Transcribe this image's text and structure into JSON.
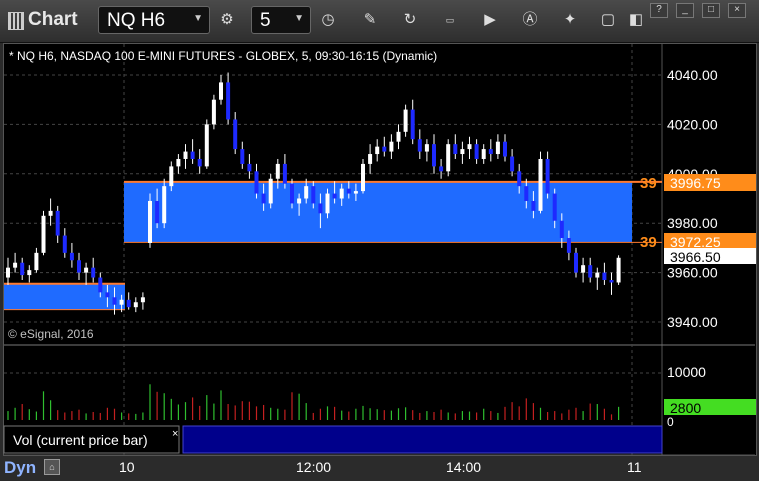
{
  "window": {
    "title": "Chart"
  },
  "toolbar": {
    "symbol": "NQ H6",
    "interval": "5",
    "icons": [
      "settings-icon",
      "clock-icon",
      "pencil-icon",
      "refresh-icon",
      "get-icon",
      "play-icon",
      "a-icon",
      "drawing-tools-icon",
      "comment-icon",
      "template-icon"
    ]
  },
  "window_buttons": [
    "?",
    "_",
    "□",
    "×"
  ],
  "chart": {
    "header": "* NQ H6, NASDAQ 100 E-MINI FUTURES - GLOBEX, 5, 09:30-16:15 (Dynamic)",
    "watermark": "© eSignal, 2016",
    "price_ticks": [
      "4040.00",
      "4020.00",
      "4000.00",
      "3980.00",
      "3960.00",
      "3940.00"
    ],
    "price_tick_values": [
      4040,
      4020,
      4000,
      3980,
      3960,
      3940
    ],
    "time_ticks": [
      "10",
      "12:00",
      "14:00",
      "11"
    ],
    "zone_labels": {
      "upper": {
        "prefix": "39",
        "price": "3996.75",
        "value": 3996.75
      },
      "lower": {
        "prefix": "39",
        "price": "3972.25",
        "value": 3972.25
      },
      "last": {
        "price": "3966.50",
        "value": 3966.5
      }
    },
    "zones": [
      {
        "from_bar": 0,
        "to_bar": 19,
        "top": 3955.5,
        "bottom": 3945.0
      },
      {
        "from_bar": 20,
        "to_bar": 101,
        "top": 3996.75,
        "bottom": 3972.25
      }
    ],
    "colors": {
      "up": "#ffffff",
      "down": "#1e2aff",
      "zone": "#1f6bff",
      "zone_border": "#ff7a2e",
      "vol_up": "#2fbf2f",
      "vol_down": "#c42020",
      "last_vol": "#44dd22",
      "panel_bg": "#00008b"
    }
  },
  "volume": {
    "ticks": [
      "10000",
      "0"
    ],
    "last_value": "2800",
    "label": "Vol (current price bar)",
    "close_glyph": "×"
  },
  "status": {
    "mode": "Dyn"
  },
  "chart_data": {
    "type": "candlestick",
    "title": "* NQ H6, NASDAQ 100 E-MINI FUTURES - GLOBEX, 5, 09:30-16:15 (Dynamic)",
    "ylim": [
      3930,
      4055
    ],
    "ohlc": [
      [
        3958,
        3966,
        3955,
        3962
      ],
      [
        3962,
        3968,
        3960,
        3964
      ],
      [
        3964,
        3966,
        3957,
        3959
      ],
      [
        3959,
        3963,
        3956,
        3961
      ],
      [
        3961,
        3970,
        3960,
        3968
      ],
      [
        3968,
        3985,
        3967,
        3983
      ],
      [
        3983,
        3990,
        3979,
        3985
      ],
      [
        3985,
        3987,
        3972,
        3975
      ],
      [
        3975,
        3978,
        3966,
        3968
      ],
      [
        3968,
        3972,
        3962,
        3965
      ],
      [
        3965,
        3968,
        3957,
        3960
      ],
      [
        3960,
        3964,
        3955,
        3962
      ],
      [
        3962,
        3966,
        3956,
        3958
      ],
      [
        3958,
        3960,
        3950,
        3952
      ],
      [
        3952,
        3955,
        3946,
        3950
      ],
      [
        3950,
        3954,
        3943,
        3947
      ],
      [
        3947,
        3951,
        3944,
        3949
      ],
      [
        3949,
        3952,
        3945,
        3946
      ],
      [
        3946,
        3950,
        3944,
        3948
      ],
      [
        3948,
        3952,
        3945,
        3950
      ],
      [
        3972,
        3992,
        3970,
        3989
      ],
      [
        3989,
        3994,
        3978,
        3980
      ],
      [
        3980,
        3998,
        3978,
        3995
      ],
      [
        3995,
        4005,
        3993,
        4003
      ],
      [
        4003,
        4008,
        4000,
        4006
      ],
      [
        4006,
        4012,
        4002,
        4009
      ],
      [
        4009,
        4014,
        4004,
        4006
      ],
      [
        4006,
        4010,
        4000,
        4003
      ],
      [
        4003,
        4022,
        4002,
        4020
      ],
      [
        4020,
        4032,
        4018,
        4030
      ],
      [
        4030,
        4040,
        4028,
        4037
      ],
      [
        4037,
        4041,
        4020,
        4022
      ],
      [
        4022,
        4025,
        4008,
        4010
      ],
      [
        4010,
        4013,
        4002,
        4004
      ],
      [
        4004,
        4008,
        3998,
        4001
      ],
      [
        4001,
        4004,
        3990,
        3992
      ],
      [
        3992,
        3996,
        3985,
        3988
      ],
      [
        3988,
        4000,
        3986,
        3998
      ],
      [
        3998,
        4006,
        3994,
        4004
      ],
      [
        4004,
        4008,
        3994,
        3996
      ],
      [
        3996,
        3998,
        3986,
        3988
      ],
      [
        3988,
        3992,
        3983,
        3990
      ],
      [
        3990,
        3998,
        3988,
        3995
      ],
      [
        3995,
        3997,
        3986,
        3988
      ],
      [
        3988,
        3992,
        3978,
        3984
      ],
      [
        3984,
        3994,
        3982,
        3992
      ],
      [
        3992,
        3997,
        3988,
        3990
      ],
      [
        3990,
        3996,
        3987,
        3994
      ],
      [
        3994,
        3997,
        3990,
        3992
      ],
      [
        3992,
        3996,
        3989,
        3993
      ],
      [
        3993,
        4006,
        3992,
        4004
      ],
      [
        4004,
        4012,
        4000,
        4008
      ],
      [
        4008,
        4014,
        4005,
        4011
      ],
      [
        4011,
        4015,
        4007,
        4009
      ],
      [
        4009,
        4016,
        4006,
        4013
      ],
      [
        4013,
        4020,
        4010,
        4017
      ],
      [
        4017,
        4028,
        4015,
        4026
      ],
      [
        4026,
        4030,
        4012,
        4014
      ],
      [
        4014,
        4018,
        4006,
        4009
      ],
      [
        4009,
        4014,
        4005,
        4012
      ],
      [
        4012,
        4016,
        4000,
        4003
      ],
      [
        4003,
        4006,
        3998,
        4001
      ],
      [
        4001,
        4014,
        3999,
        4012
      ],
      [
        4012,
        4016,
        4006,
        4008
      ],
      [
        4008,
        4013,
        4004,
        4010
      ],
      [
        4010,
        4015,
        4006,
        4012
      ],
      [
        4012,
        4014,
        4004,
        4006
      ],
      [
        4006,
        4012,
        4004,
        4010
      ],
      [
        4010,
        4014,
        4005,
        4008
      ],
      [
        4008,
        4016,
        4006,
        4013
      ],
      [
        4013,
        4016,
        4005,
        4007
      ],
      [
        4007,
        4010,
        3999,
        4001
      ],
      [
        4001,
        4004,
        3992,
        3995
      ],
      [
        3995,
        3998,
        3986,
        3989
      ],
      [
        3989,
        3993,
        3982,
        3985
      ],
      [
        3985,
        4009,
        3984,
        4006
      ],
      [
        4006,
        4009,
        3990,
        3992
      ],
      [
        3992,
        3994,
        3978,
        3981
      ],
      [
        3981,
        3984,
        3970,
        3974
      ],
      [
        3974,
        3977,
        3965,
        3968
      ],
      [
        3968,
        3970,
        3958,
        3960
      ],
      [
        3960,
        3966,
        3956,
        3963
      ],
      [
        3963,
        3966,
        3956,
        3958
      ],
      [
        3958,
        3962,
        3953,
        3960
      ],
      [
        3960,
        3964,
        3955,
        3957
      ],
      [
        3957,
        3960,
        3951,
        3956
      ],
      [
        3956,
        3967,
        3955,
        3966
      ]
    ],
    "volume": [
      1900,
      2600,
      3400,
      2300,
      1800,
      6100,
      4200,
      2100,
      1600,
      1900,
      2200,
      1400,
      1700,
      1500,
      2600,
      2400,
      1600,
      1400,
      1300,
      1600,
      7600,
      6000,
      5700,
      4500,
      3300,
      3800,
      4800,
      3000,
      5300,
      3500,
      6300,
      3400,
      3100,
      4000,
      3900,
      2900,
      3200,
      2600,
      2400,
      2200,
      5900,
      5600,
      3600,
      1500,
      2400,
      2900,
      2800,
      2000,
      1800,
      2400,
      3000,
      2500,
      2300,
      2100,
      2000,
      2500,
      2700,
      2100,
      1500,
      1900,
      1700,
      2200,
      1600,
      1400,
      1900,
      1800,
      1600,
      2400,
      1900,
      1500,
      2800,
      3800,
      2900,
      4600,
      3600,
      2600,
      1700,
      1900,
      1400,
      2200,
      2600,
      1900,
      3500,
      3400,
      2400,
      1200,
      2800
    ]
  }
}
